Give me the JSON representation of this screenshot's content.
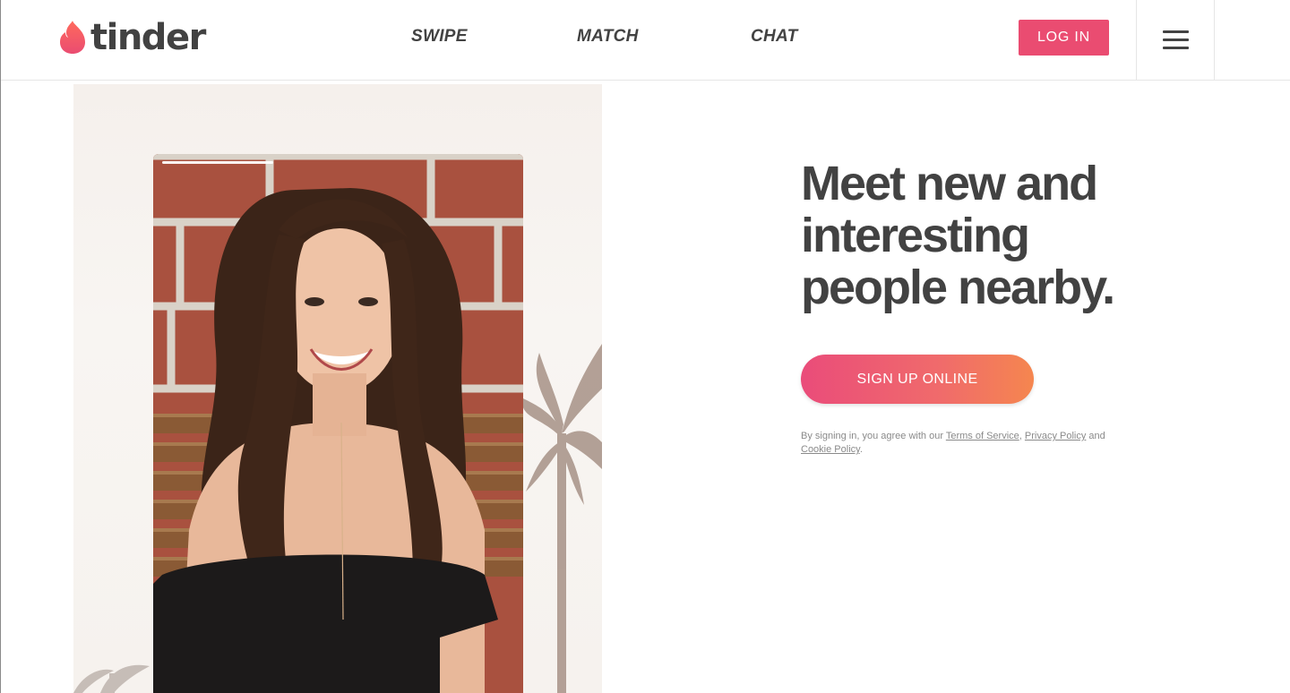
{
  "brand": {
    "name": "tinder",
    "accent_color": "#ea4c71",
    "flame_gradient": [
      "#f85a6b",
      "#ea4c71"
    ]
  },
  "header": {
    "nav": [
      {
        "label": "SWIPE"
      },
      {
        "label": "MATCH"
      },
      {
        "label": "CHAT"
      }
    ],
    "login_label": "LOG IN",
    "menu_icon": "hamburger-menu-icon"
  },
  "hero": {
    "title_lines": [
      "Meet new and",
      "interesting",
      "people nearby."
    ],
    "signup_label": "SIGN UP ONLINE",
    "signup_gradient": [
      "#ea4c7a",
      "#f5864f"
    ],
    "legal": {
      "prefix": "By signing in, you agree with our ",
      "terms": "Terms of Service",
      "comma": ", ",
      "privacy": "Privacy Policy",
      "and": " and",
      "cookie": "Cookie Policy",
      "suffix": "."
    }
  }
}
